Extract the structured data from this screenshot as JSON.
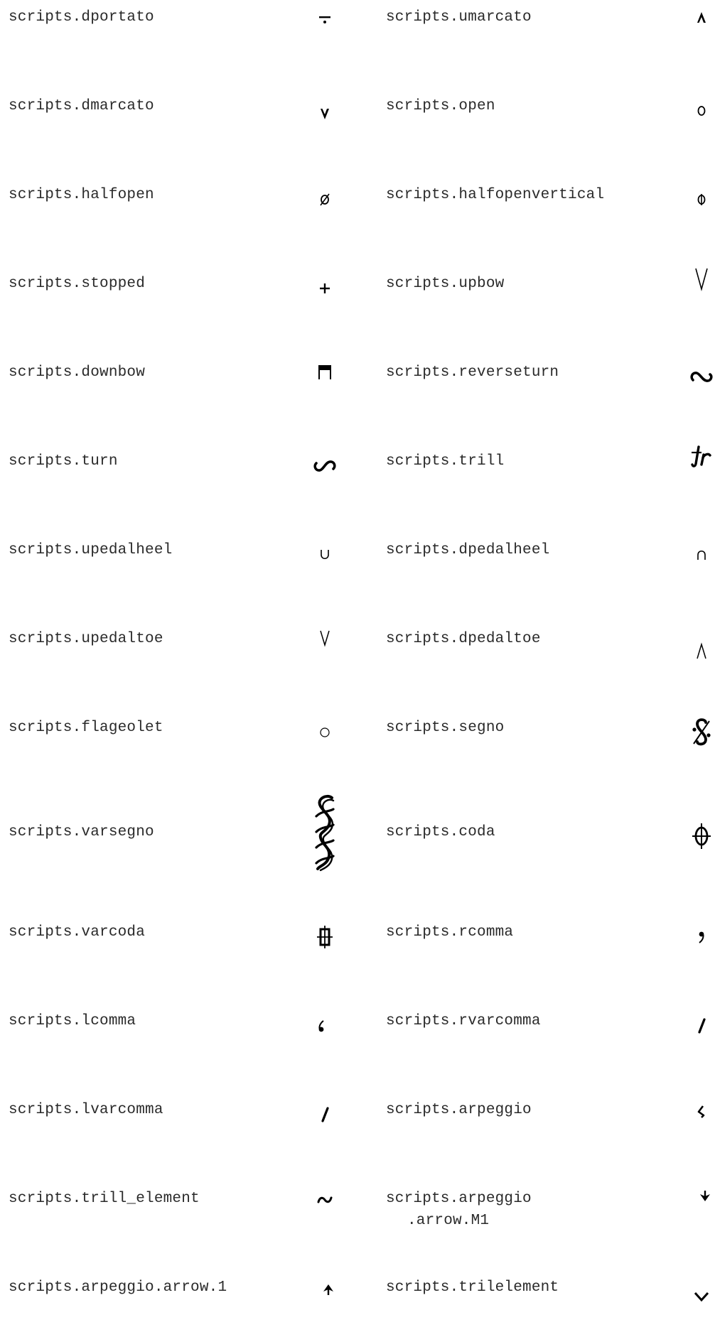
{
  "entries": [
    {
      "name": "scripts.dportato",
      "cont": "",
      "icon": "dportato-icon"
    },
    {
      "name": "scripts.umarcato",
      "cont": "",
      "icon": "umarcato-icon"
    },
    {
      "name": "scripts.dmarcato",
      "cont": "",
      "icon": "dmarcato-icon"
    },
    {
      "name": "scripts.open",
      "cont": "",
      "icon": "open-icon"
    },
    {
      "name": "scripts.halfopen",
      "cont": "",
      "icon": "halfopen-icon"
    },
    {
      "name": "scripts.halfopenvertical",
      "cont": "",
      "icon": "halfopenvertical-icon"
    },
    {
      "name": "scripts.stopped",
      "cont": "",
      "icon": "stopped-icon"
    },
    {
      "name": "scripts.upbow",
      "cont": "",
      "icon": "upbow-icon"
    },
    {
      "name": "scripts.downbow",
      "cont": "",
      "icon": "downbow-icon"
    },
    {
      "name": "scripts.reverseturn",
      "cont": "",
      "icon": "reverseturn-icon"
    },
    {
      "name": "scripts.turn",
      "cont": "",
      "icon": "turn-icon"
    },
    {
      "name": "scripts.trill",
      "cont": "",
      "icon": "trill-icon"
    },
    {
      "name": "scripts.upedalheel",
      "cont": "",
      "icon": "upedalheel-icon"
    },
    {
      "name": "scripts.dpedalheel",
      "cont": "",
      "icon": "dpedalheel-icon"
    },
    {
      "name": "scripts.upedaltoe",
      "cont": "",
      "icon": "upedaltoe-icon"
    },
    {
      "name": "scripts.dpedaltoe",
      "cont": "",
      "icon": "dpedaltoe-icon"
    },
    {
      "name": "scripts.flageolet",
      "cont": "",
      "icon": "flageolet-icon"
    },
    {
      "name": "scripts.segno",
      "cont": "",
      "icon": "segno-icon"
    },
    {
      "name": "scripts.varsegno",
      "cont": "",
      "icon": "varsegno-icon"
    },
    {
      "name": "scripts.coda",
      "cont": "",
      "icon": "coda-icon"
    },
    {
      "name": "scripts.varcoda",
      "cont": "",
      "icon": "varcoda-icon"
    },
    {
      "name": "scripts.rcomma",
      "cont": "",
      "icon": "rcomma-icon"
    },
    {
      "name": "scripts.lcomma",
      "cont": "",
      "icon": "lcomma-icon"
    },
    {
      "name": "scripts.rvarcomma",
      "cont": "",
      "icon": "rvarcomma-icon"
    },
    {
      "name": "scripts.lvarcomma",
      "cont": "",
      "icon": "lvarcomma-icon"
    },
    {
      "name": "scripts.arpeggio",
      "cont": "",
      "icon": "arpeggio-icon"
    },
    {
      "name": "scripts.trill_element",
      "cont": "",
      "icon": "trill-element-icon"
    },
    {
      "name": "scripts.arpeggio",
      "cont": ".arrow.M1",
      "icon": "arpeggio-arrow-m1-icon"
    },
    {
      "name": "scripts.arpeggio.arrow.1",
      "cont": "",
      "icon": "arpeggio-arrow-1-icon"
    },
    {
      "name": "scripts.trilelement",
      "cont": "",
      "icon": "trilelement-icon"
    }
  ]
}
